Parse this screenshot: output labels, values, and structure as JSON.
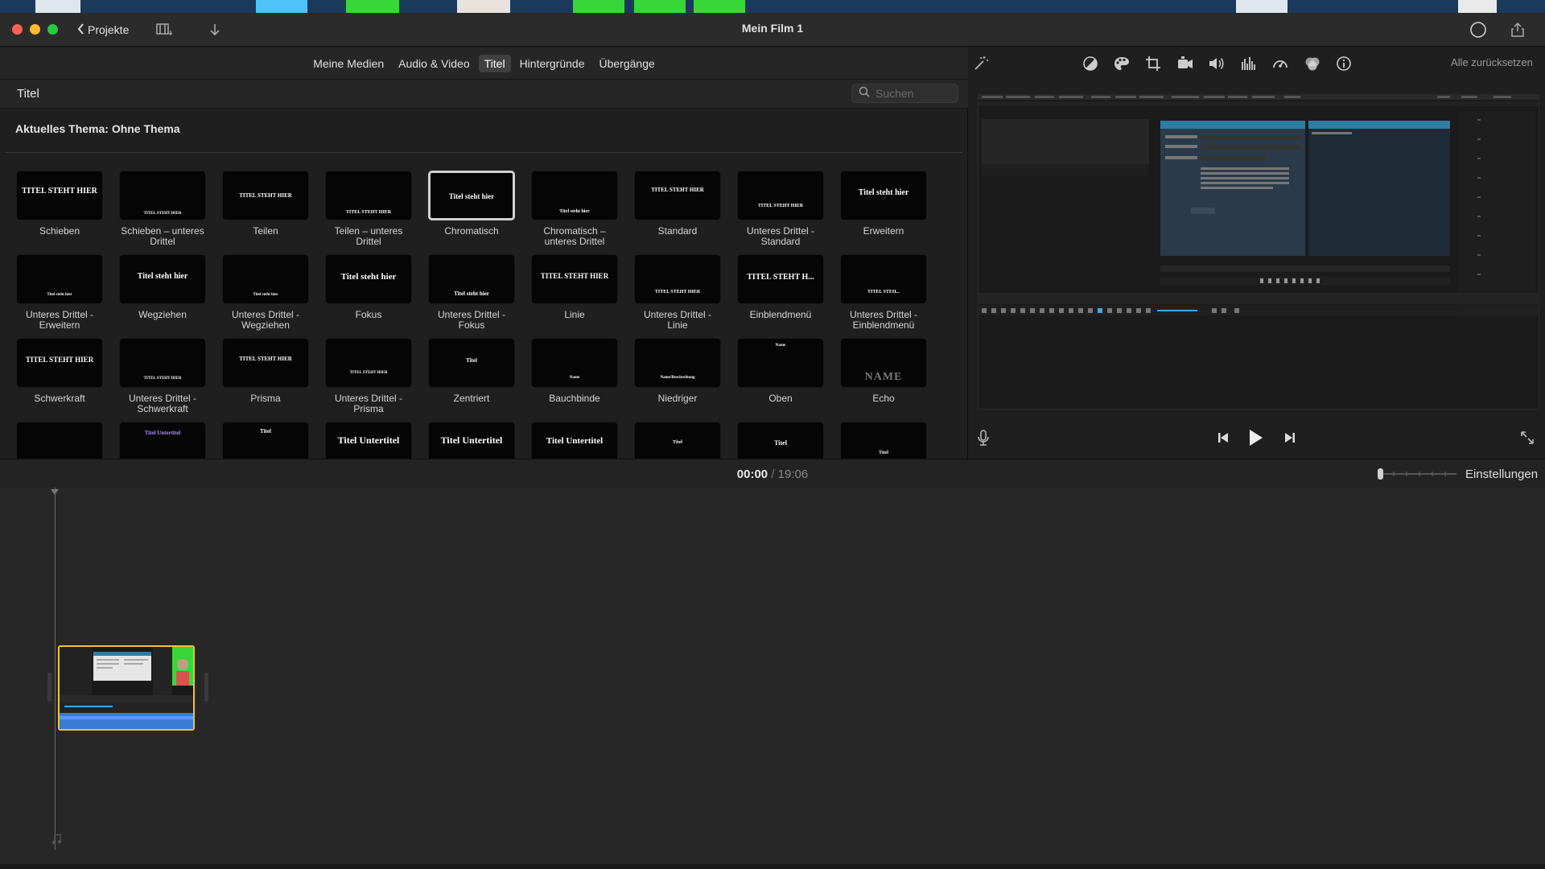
{
  "window": {
    "title": "Mein Film 1",
    "back_label": "Projekte"
  },
  "browser": {
    "tabs": [
      {
        "label": "Meine Medien",
        "active": false
      },
      {
        "label": "Audio & Video",
        "active": false
      },
      {
        "label": "Titel",
        "active": true
      },
      {
        "label": "Hintergründe",
        "active": false
      },
      {
        "label": "Übergänge",
        "active": false
      }
    ],
    "section_title": "Titel",
    "search_placeholder": "Suchen",
    "theme_label": "Aktuelles Thema: Ohne Thema",
    "titles": [
      {
        "label": "Schieben",
        "thumb": "TITEL STEHT HIER"
      },
      {
        "label": "Schieben – unteres Drittel",
        "thumb": "TITEL STEHT HIER"
      },
      {
        "label": "Teilen",
        "thumb": "TITEL STEHT HIER"
      },
      {
        "label": "Teilen – unteres Drittel",
        "thumb": "TITEL STEHT HIER"
      },
      {
        "label": "Chromatisch",
        "thumb": "Titel steht hier",
        "selected": true
      },
      {
        "label": "Chromatisch – unteres Drittel",
        "thumb": "Titel steht hier"
      },
      {
        "label": "Standard",
        "thumb": "TITEL STEHT HIER"
      },
      {
        "label": "Unteres Drittel - Standard",
        "thumb": "TITEL STEHT HIER"
      },
      {
        "label": "Erweitern",
        "thumb": "Titel steht hier"
      },
      {
        "label": "Unteres Drittel - Erweitern",
        "thumb": "Titel steht hier"
      },
      {
        "label": "Wegziehen",
        "thumb": "Titel steht hier"
      },
      {
        "label": "Unteres Drittel - Wegziehen",
        "thumb": "Titel steht hier"
      },
      {
        "label": "Fokus",
        "thumb": "Titel steht hier"
      },
      {
        "label": "Unteres Drittel - Fokus",
        "thumb": "Titel steht hier"
      },
      {
        "label": "Linie",
        "thumb": "TITEL STEHT HIER"
      },
      {
        "label": "Unteres Drittel - Linie",
        "thumb": "TITEL STEHT HIER"
      },
      {
        "label": "Einblendmenü",
        "thumb": "TITEL STEHT H..."
      },
      {
        "label": "Unteres Drittel - Einblendmenü",
        "thumb": "TITEL STEH..."
      },
      {
        "label": "Schwerkraft",
        "thumb": "TITEL STEHT HIER"
      },
      {
        "label": "Unteres Drittel - Schwerkraft",
        "thumb": "TITEL STEHT HIER"
      },
      {
        "label": "Prisma",
        "thumb": "TITEL STEHT HIER"
      },
      {
        "label": "Unteres Drittel - Prisma",
        "thumb": "TITEL STEHT HIER"
      },
      {
        "label": "Zentriert",
        "thumb": "Titel"
      },
      {
        "label": "Bauchbinde",
        "thumb": "Name"
      },
      {
        "label": "Niedriger",
        "thumb": "Name/Beschreibung"
      },
      {
        "label": "Oben",
        "thumb": "Name"
      },
      {
        "label": "Echo",
        "thumb": "NAME"
      },
      {
        "label": "",
        "thumb": ""
      },
      {
        "label": "",
        "thumb": "Titel Untertitel"
      },
      {
        "label": "",
        "thumb": "Titel"
      },
      {
        "label": "",
        "thumb": "Titel Untertitel"
      },
      {
        "label": "",
        "thumb": "Titel Untertitel"
      },
      {
        "label": "",
        "thumb": "Titel Untertitel"
      },
      {
        "label": "",
        "thumb": "Titel"
      },
      {
        "label": "",
        "thumb": "Titel"
      },
      {
        "label": "",
        "thumb": "Titel"
      }
    ]
  },
  "viewer": {
    "reset_label": "Alle zurücksetzen",
    "tool_icons": [
      "color-balance-icon",
      "color-correction-icon",
      "crop-icon",
      "stabilization-icon",
      "volume-icon",
      "noise-reduction-icon",
      "speed-icon",
      "clip-filter-icon",
      "info-icon"
    ]
  },
  "timeline": {
    "current_time": "00:00",
    "separator": "/",
    "total_time": "19:06",
    "settings_label": "Einstellungen"
  },
  "colors": {
    "accent_clip_border": "#f1c232",
    "close": "#fe5f57",
    "minimize": "#febc2e",
    "maximize": "#28c840"
  }
}
